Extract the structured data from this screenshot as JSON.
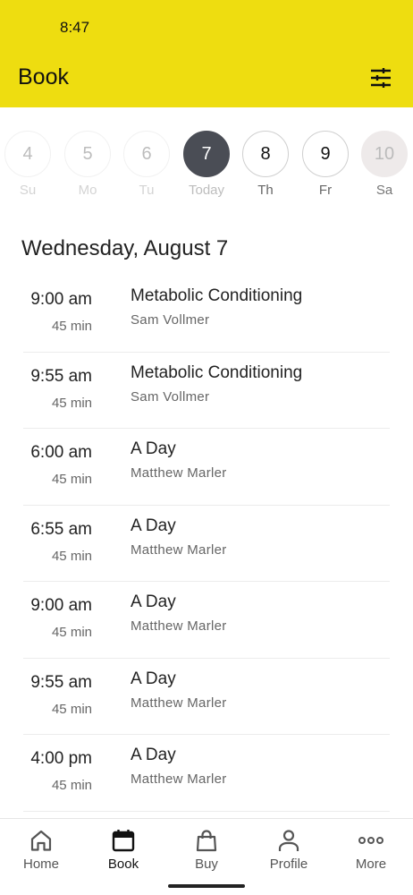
{
  "status_bar": {
    "time": "8:47"
  },
  "header": {
    "title": "Book",
    "filter_icon": "sliders-icon",
    "background_color": "#eedd10"
  },
  "days": [
    {
      "number": "4",
      "label": "Su",
      "state": "faded"
    },
    {
      "number": "5",
      "label": "Mo",
      "state": "faded"
    },
    {
      "number": "6",
      "label": "Tu",
      "state": "faded"
    },
    {
      "number": "7",
      "label": "Today",
      "state": "selected"
    },
    {
      "number": "8",
      "label": "Th",
      "state": "normal"
    },
    {
      "number": "9",
      "label": "Fr",
      "state": "normal"
    },
    {
      "number": "10",
      "label": "Sa",
      "state": "disabled"
    }
  ],
  "date_heading": "Wednesday, August 7",
  "classes": [
    {
      "time": "9:00 am",
      "duration": "45 min",
      "name": "Metabolic Conditioning",
      "instructor": "Sam Vollmer"
    },
    {
      "time": "9:55 am",
      "duration": "45 min",
      "name": "Metabolic Conditioning",
      "instructor": "Sam Vollmer"
    },
    {
      "time": "6:00 am",
      "duration": "45 min",
      "name": "A Day",
      "instructor": "Matthew Marler"
    },
    {
      "time": "6:55 am",
      "duration": "45 min",
      "name": "A Day",
      "instructor": "Matthew Marler"
    },
    {
      "time": "9:00 am",
      "duration": "45 min",
      "name": "A Day",
      "instructor": "Matthew Marler"
    },
    {
      "time": "9:55 am",
      "duration": "45 min",
      "name": "A Day",
      "instructor": "Matthew Marler"
    },
    {
      "time": "4:00 pm",
      "duration": "45 min",
      "name": "A Day",
      "instructor": "Matthew Marler"
    }
  ],
  "nav": [
    {
      "label": "Home",
      "icon": "home-icon"
    },
    {
      "label": "Book",
      "icon": "calendar-icon",
      "active": true
    },
    {
      "label": "Buy",
      "icon": "shopping-bag-icon"
    },
    {
      "label": "Profile",
      "icon": "person-icon"
    },
    {
      "label": "More",
      "icon": "more-dots-icon"
    }
  ]
}
